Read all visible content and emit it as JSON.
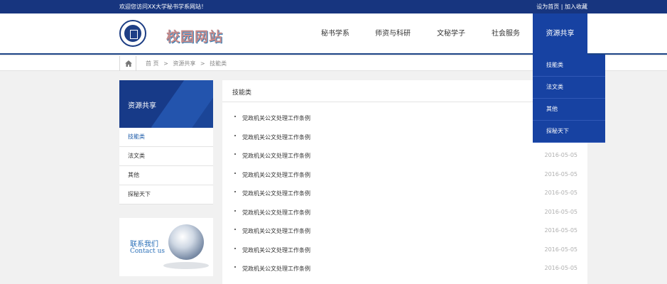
{
  "topbar": {
    "welcome": "欢迎您访问XX大学秘书学系网站！",
    "links": "设为首页 | 加入收藏"
  },
  "header": {
    "logo_text": "校园网站"
  },
  "nav": {
    "items": [
      {
        "label": "秘书学系"
      },
      {
        "label": "师资与科研"
      },
      {
        "label": "文秘学子"
      },
      {
        "label": "社会服务"
      },
      {
        "label": "资源共享"
      }
    ],
    "active_index": 4
  },
  "dropdown": {
    "items": [
      {
        "label": "技能类"
      },
      {
        "label": "法文类"
      },
      {
        "label": "其他"
      },
      {
        "label": "探秘天下"
      }
    ]
  },
  "breadcrumb": {
    "items": [
      "首 页",
      ">",
      "资源共享",
      ">",
      "技能类"
    ]
  },
  "sidebar": {
    "title": "资源共享",
    "items": [
      {
        "label": "技能类"
      },
      {
        "label": "法文类"
      },
      {
        "label": "其他"
      },
      {
        "label": "探秘天下"
      }
    ]
  },
  "contact": {
    "cn": "联系我们",
    "en": "Contact us"
  },
  "content": {
    "title": "技能类",
    "rows": [
      {
        "title": "党政机关公文处理工作条例",
        "date": ""
      },
      {
        "title": "党政机关公文处理工作条例",
        "date": ""
      },
      {
        "title": "党政机关公文处理工作条例",
        "date": "2016-05-05"
      },
      {
        "title": "党政机关公文处理工作条例",
        "date": "2016-05-05"
      },
      {
        "title": "党政机关公文处理工作条例",
        "date": "2016-05-05"
      },
      {
        "title": "党政机关公文处理工作条例",
        "date": "2016-05-05"
      },
      {
        "title": "党政机关公文处理工作条例",
        "date": "2016-05-05"
      },
      {
        "title": "党政机关公文处理工作条例",
        "date": "2016-05-05"
      },
      {
        "title": "党政机关公文处理工作条例",
        "date": "2016-05-05"
      }
    ]
  },
  "colors": {
    "brand_dark": "#17357f",
    "nav_active": "#1742a2"
  }
}
